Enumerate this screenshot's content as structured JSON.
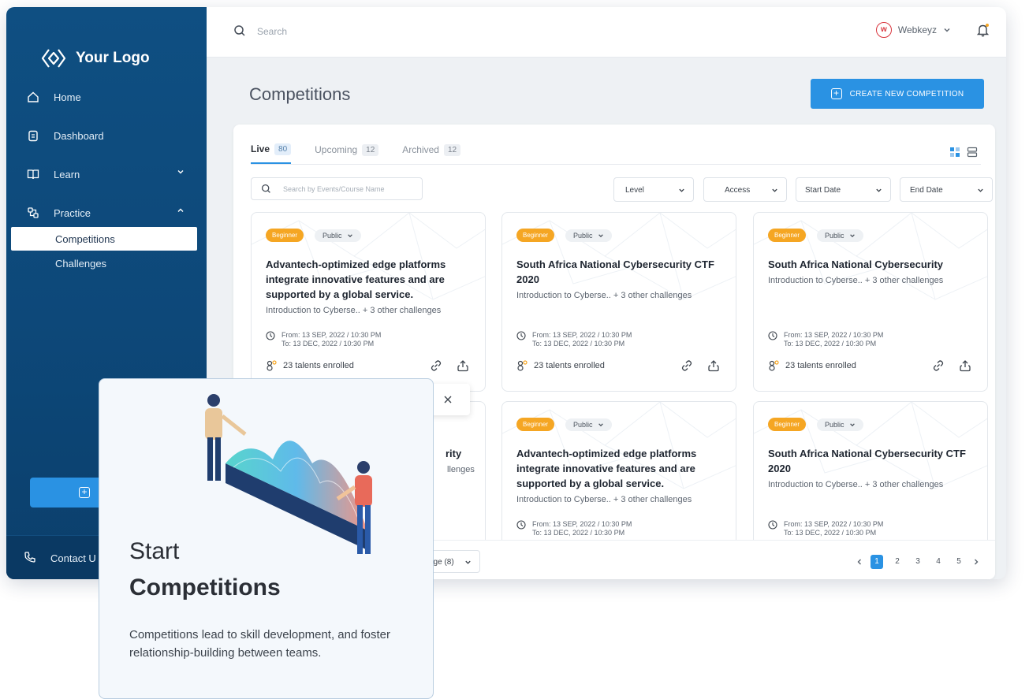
{
  "brand": {
    "logo_text": "Your Logo"
  },
  "sidebar": {
    "items": [
      {
        "label": "Home",
        "icon": "home-icon"
      },
      {
        "label": "Dashboard",
        "icon": "clipboard-icon"
      },
      {
        "label": "Learn",
        "icon": "book-icon"
      },
      {
        "label": "Practice",
        "icon": "practice-icon"
      }
    ],
    "subitems": [
      "Competitions",
      "Challenges"
    ],
    "footer_label": "Contact U"
  },
  "header": {
    "search_placeholder": "Search",
    "user_name": "Webkeyz",
    "avatar_letter": "w"
  },
  "page": {
    "title": "Competitions",
    "create_label": "CREATE NEW COMPETITION"
  },
  "tabs": [
    {
      "label": "Live",
      "count": "80"
    },
    {
      "label": "Upcoming",
      "count": "12"
    },
    {
      "label": "Archived",
      "count": "12"
    }
  ],
  "filters": {
    "search_placeholder": "Search by Events/Course Name",
    "level": "Level",
    "access": "Access",
    "start_date": "Start Date",
    "end_date": "End Date"
  },
  "cards": [
    {
      "level": "Beginner",
      "access": "Public",
      "title": "Advantech-optimized edge platforms integrate innovative features and are supported by a global service.",
      "subtitle": "Introduction to Cyberse.. + 3 other challenges",
      "from": "From: 13 SEP, 2022   / 10:30 PM",
      "to": "To:     13 DEC, 2022  / 10:30 PM",
      "enrolled": "23 talents enrolled"
    },
    {
      "level": "Beginner",
      "access": "Public",
      "title": "South Africa National Cybersecurity CTF 2020",
      "subtitle": "Introduction to Cyberse.. + 3 other challenges",
      "from": "From: 13 SEP, 2022   / 10:30 PM",
      "to": "To:     13 DEC, 2022  / 10:30 PM",
      "enrolled": "23 talents enrolled"
    },
    {
      "level": "Beginner",
      "access": "Public",
      "title": "South Africa National Cybersecurity",
      "subtitle": "Introduction to Cyberse.. + 3 other challenges",
      "from": "From: 13 SEP, 2022   / 10:30 PM",
      "to": "To:     13 DEC, 2022  / 10:30 PM",
      "enrolled": "23 talents enrolled"
    },
    {
      "title_fragment": "rity",
      "subtitle_fragment": "llenges"
    },
    {
      "level": "Beginner",
      "access": "Public",
      "title": "Advantech-optimized edge platforms integrate innovative features and are supported by a global service.",
      "subtitle": "Introduction to Cyberse.. + 3 other challenges",
      "from": "From: 13 SEP, 2022   / 10:30 PM",
      "to": "To:     13 DEC, 2022  / 10:30 PM"
    },
    {
      "level": "Beginner",
      "access": "Public",
      "title": "South Africa National Cybersecurity CTF 2020",
      "subtitle": "Introduction to Cyberse.. + 3 other challenges",
      "from": "From: 13 SEP, 2022   / 10:30 PM",
      "to": "To:     13 DEC, 2022  / 10:30 PM"
    }
  ],
  "pagination": {
    "per_page": "age (8)",
    "pages": [
      "1",
      "2",
      "3",
      "4",
      "5"
    ],
    "current": "1"
  },
  "promo": {
    "line1": "Start",
    "line2": "Competitions",
    "description": "Competitions lead to skill development, and foster relationship-building between teams."
  },
  "colors": {
    "primary": "#2a92e3",
    "sidebar": "#0f4f82",
    "beginner": "#f5a623"
  }
}
